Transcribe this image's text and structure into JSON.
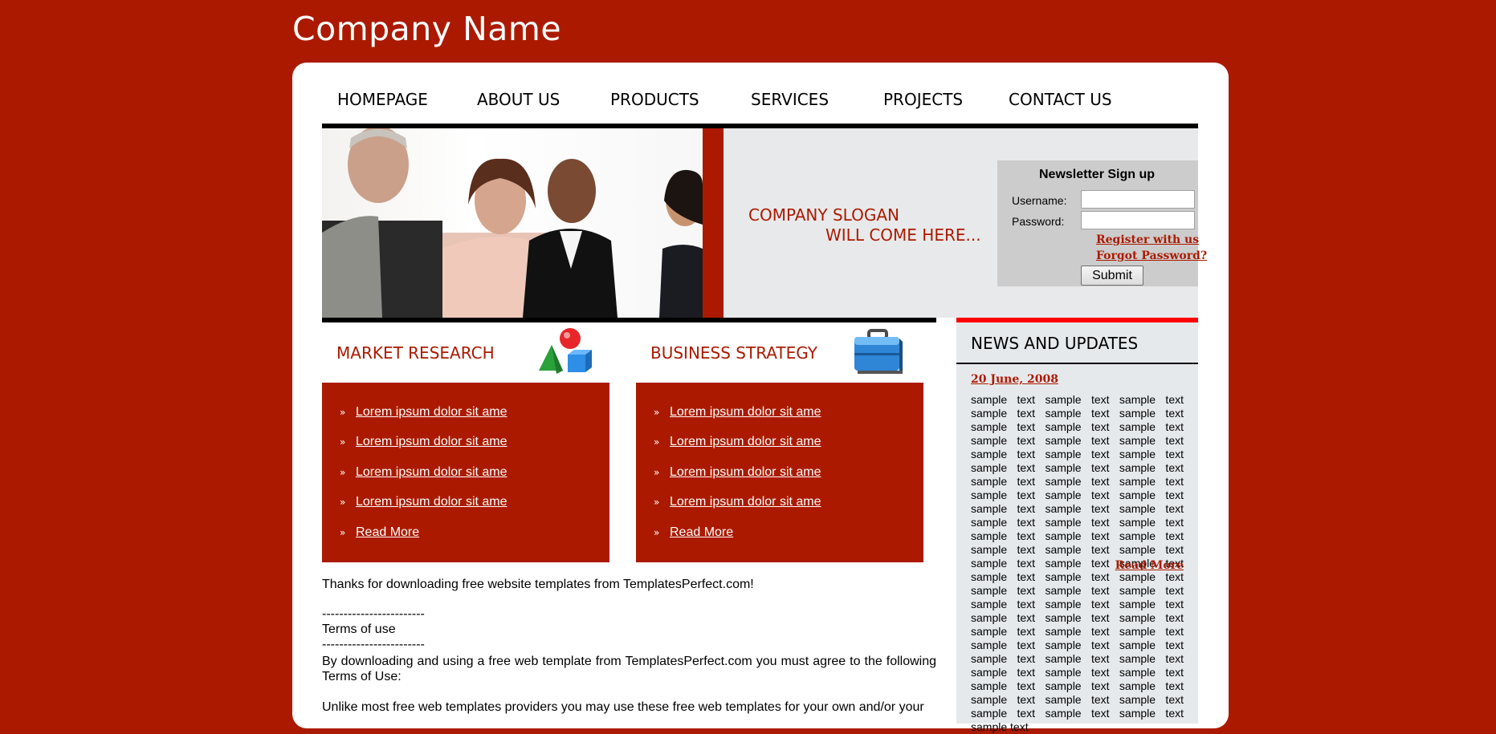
{
  "header": {
    "company_name": "Company Name"
  },
  "nav": {
    "items": [
      "HOMEPAGE",
      "ABOUT US",
      "PRODUCTS",
      "SERVICES",
      "PROJECTS",
      "CONTACT US"
    ]
  },
  "hero": {
    "slogan_line1": "COMPANY SLOGAN",
    "slogan_line2": "WILL COME HERE..."
  },
  "newsletter": {
    "title": "Newsletter Sign up",
    "username_label": "Username:",
    "password_label": "Password:",
    "username_value": "",
    "password_value": "",
    "register_link": "Register with us",
    "forgot_link": "Forgot Password?",
    "submit_label": "Submit"
  },
  "sections": [
    {
      "title": "MARKET RESEARCH",
      "icon": "shapes-icon",
      "links": [
        "Lorem ipsum dolor sit ame",
        "Lorem ipsum dolor sit ame",
        "Lorem ipsum dolor sit ame",
        "Lorem ipsum dolor sit ame",
        "Read More"
      ]
    },
    {
      "title": "BUSINESS STRATEGY",
      "icon": "briefcase-icon",
      "links": [
        "Lorem ipsum dolor sit ame",
        "Lorem ipsum dolor sit ame",
        "Lorem ipsum dolor sit ame",
        "Lorem ipsum dolor sit ame",
        "Read More"
      ]
    }
  ],
  "content": {
    "thanks": "Thanks for downloading free website templates from TemplatesPerfect.com!",
    "separator": "------------------------",
    "terms_title": "Terms of use",
    "terms_intro": "By downloading and using a free web template from TemplatesPerfect.com you must agree to the following Terms of Use:",
    "terms_p1": "Unlike most free web templates providers you may use these free web templates for your own and/or your"
  },
  "news": {
    "title": "NEWS AND UPDATES",
    "date": "20 June, 2008",
    "body": "sample text sample text sample text sample text sample text sample text sample text sample text sample text sample text sample text sample text sample text sample text sample text sample text sample text sample text sample text sample text sample text sample text sample text sample text sample text sample text sample text sample text sample text sample text sample text sample text sample text sample text sample text sample text sample text sample text sample text sample text sample text sample text sample text sample text sample text sample text sample text sample text sample text sample text sample text sample text sample text sample text sample text sample text sample text sample text sample text sample text sample text sample text sample text sample text sample text sample text sample text sample text sample text sample text sample text sample text sample text",
    "read_more": "Read More"
  },
  "colors": {
    "brand_red": "#ab1a00",
    "accent_red": "#ff0000",
    "news_bg": "#e6e9ec",
    "hero_gray": "#e8e9ea"
  }
}
